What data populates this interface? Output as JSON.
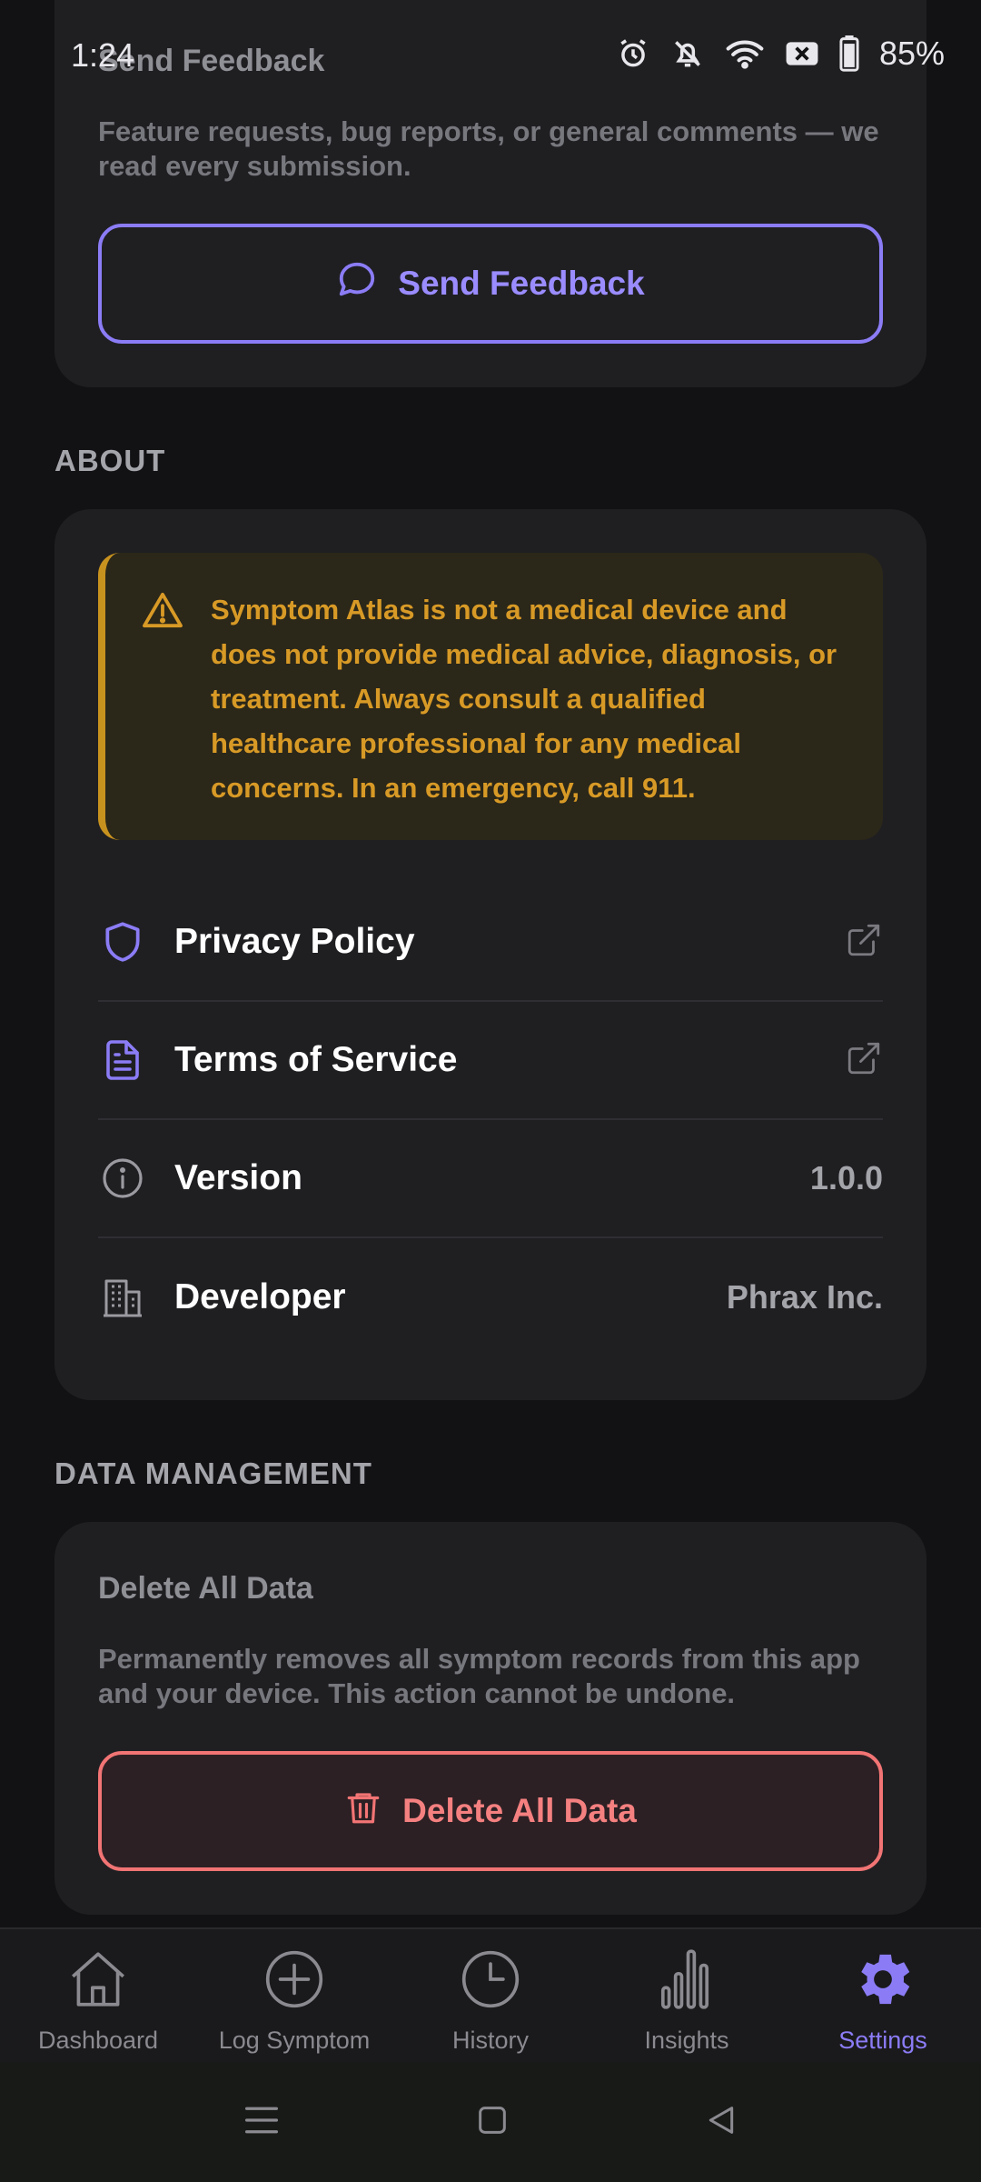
{
  "status_bar": {
    "time": "1:24",
    "battery": "85%"
  },
  "feedback": {
    "title": "Send Feedback",
    "description": "Feature requests, bug reports, or general comments — we read every submission.",
    "button_label": "Send Feedback"
  },
  "about": {
    "section_label": "ABOUT",
    "warning": "Symptom Atlas is not a medical device and does not provide medical advice, diagnosis, or treatment. Always consult a qualified healthcare professional for any medical concerns. In an emergency, call 911.",
    "rows": [
      {
        "label": "Privacy Policy",
        "icon": "shield-icon"
      },
      {
        "label": "Terms of Service",
        "icon": "document-icon"
      },
      {
        "label": "Version",
        "value": "1.0.0",
        "icon": "info-icon"
      },
      {
        "label": "Developer",
        "value": "Phrax Inc.",
        "icon": "building-icon"
      }
    ]
  },
  "data_management": {
    "section_label": "DATA MANAGEMENT",
    "title": "Delete All Data",
    "description": "Permanently removes all symptom records from this app and your device. This action cannot be undone.",
    "button_label": "Delete All Data"
  },
  "nav": {
    "items": [
      {
        "label": "Dashboard",
        "icon": "home-icon"
      },
      {
        "label": "Log Symptom",
        "icon": "plus-circle-icon"
      },
      {
        "label": "History",
        "icon": "clock-icon"
      },
      {
        "label": "Insights",
        "icon": "bar-chart-icon"
      },
      {
        "label": "Settings",
        "icon": "gear-icon"
      }
    ],
    "active": "Settings"
  },
  "colors": {
    "accent": "#8b7cf6",
    "danger": "#f27474",
    "warning": "#d89a26",
    "card": "#1f1f22",
    "background": "#121214"
  }
}
